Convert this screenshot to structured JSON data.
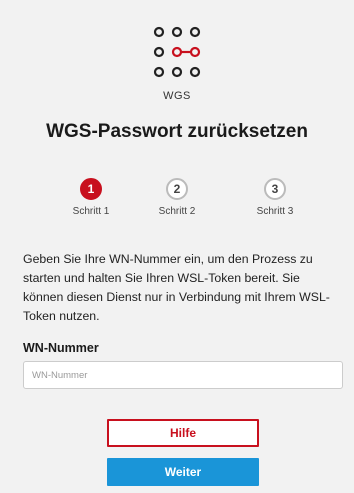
{
  "logo": {
    "icon": "wgs-logo-icon",
    "brand": "WGS",
    "accent_color": "#c8101e"
  },
  "title": "WGS-Passwort zurücksetzen",
  "steps": [
    {
      "number": "1",
      "label": "Schritt 1",
      "active": true
    },
    {
      "number": "2",
      "label": "Schritt 2",
      "active": false
    },
    {
      "number": "3",
      "label": "Schritt 3",
      "active": false
    }
  ],
  "description": "Geben Sie Ihre WN-Nummer ein, um den Prozess zu starten und halten Sie Ihren WSL-Token bereit. Sie können diesen Dienst nur in Verbindung mit Ihrem WSL-Token nutzen.",
  "form": {
    "field_label": "WN-Nummer",
    "placeholder": "WN-Nummer",
    "value": ""
  },
  "buttons": {
    "help": "Hilfe",
    "next": "Weiter",
    "help_color": "#c8101e",
    "next_color": "#1a95d8"
  }
}
